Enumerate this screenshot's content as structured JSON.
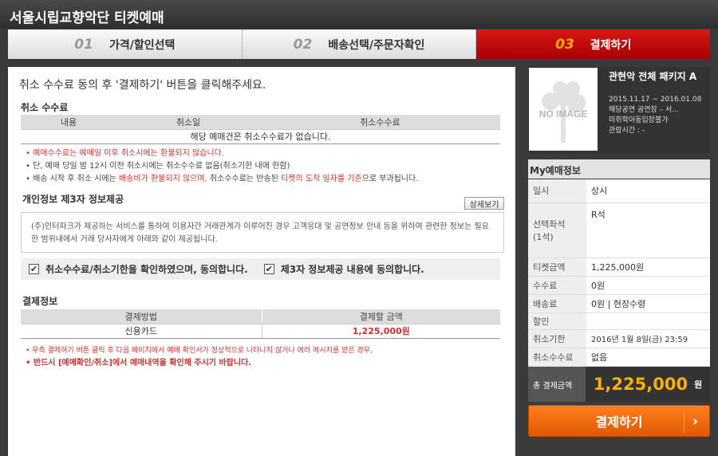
{
  "app_title": "서울시립교향악단 티켓예매",
  "steps": [
    {
      "num": "01",
      "label": "가격/할인선택"
    },
    {
      "num": "02",
      "label": "배송선택/주문자확인"
    },
    {
      "num": "03",
      "label": "결제하기"
    }
  ],
  "instruction": "취소 수수료 동의 후 '결제하기' 버튼을 클릭해주세요.",
  "cancel_fee": {
    "title": "취소 수수료",
    "headers": [
      "내용",
      "취소일",
      "취소수수료"
    ],
    "empty_message": "해당 예매건은 취소수수료가 없습니다.",
    "notes": [
      "예매수수료는 예매일 이후 취소시에는 환불되지 않습니다.",
      "단, 예매 당일 밤 12시 이전 취소시에는 취소수수료 없음(취소기한 내에 한함)"
    ],
    "note3_a": "배송 시작 후 취소 시에는 ",
    "note3_b": "배송비가 환불되지 않으며,",
    "note3_c": " 취소수수료는 반송된 ",
    "note3_d": "티켓의 도착 일자를 기준",
    "note3_e": "으로 부과됩니다."
  },
  "privacy": {
    "title": "개인정보 제3자 정보제공",
    "detail_button": "상세보기",
    "text": "(주)인터파크가 제공하는 서비스를 통하여 이용자간 거래관계가 이루어진 경우 고객응대 및 공연정보 안내 등을 위하여 관련한 정보는 필요한 범위내에서 거래 당사자에게 아래와 같이 제공됩니다."
  },
  "agree": {
    "cancel_label": "취소수수료/취소기한을 확인하였으며, 동의합니다.",
    "third_party_label": "제3자 정보제공 내용에 동의합니다.",
    "check_mark": "✔"
  },
  "payment": {
    "title": "결제정보",
    "headers": [
      "결제방법",
      "결제할 금액"
    ],
    "method": "신용카드",
    "amount": "1,225,000원",
    "note1": "우측 결제하기 버튼 클릭 후 다음 페이지에서 예매 확인서가 정상적으로 나타나지 않거나 에러 메시지를 받은 경우,",
    "note2": "반드시 [예매확인/취소]에서 예매내역을 확인해 주시기 바랍니다."
  },
  "product": {
    "image_text": "NO IMAGE",
    "title": "관현악 전체 패키지 A",
    "date": "2015.11.17 ~ 2016.01.08",
    "venue": "해당공연 공연장 – 서...",
    "age": "미취학아동입장불가",
    "runtime": "관람시간 : -"
  },
  "my_info": {
    "title": "My예매정보",
    "rows": [
      {
        "label": "일시",
        "value": "상시"
      },
      {
        "label": "선택좌석\n(1석)",
        "value": "R석"
      },
      {
        "label": "티켓금액",
        "value": "1,225,000원"
      },
      {
        "label": "수수료",
        "value": "0원"
      },
      {
        "label": "배송료",
        "value": "0원 | 현장수령"
      },
      {
        "label": "할인",
        "value": ""
      },
      {
        "label": "취소기한",
        "value": "2016년 1월 8일(금) 23:59"
      },
      {
        "label": "취소수수료",
        "value": "없음"
      }
    ],
    "total_label": "총 결제금액",
    "total_value": "1,225,000",
    "total_unit": "원"
  },
  "pay_button": "결제하기",
  "colors": {
    "accent_red": "#c00000",
    "pay_orange": "#f06a10",
    "total_gold": "#ffb000"
  }
}
